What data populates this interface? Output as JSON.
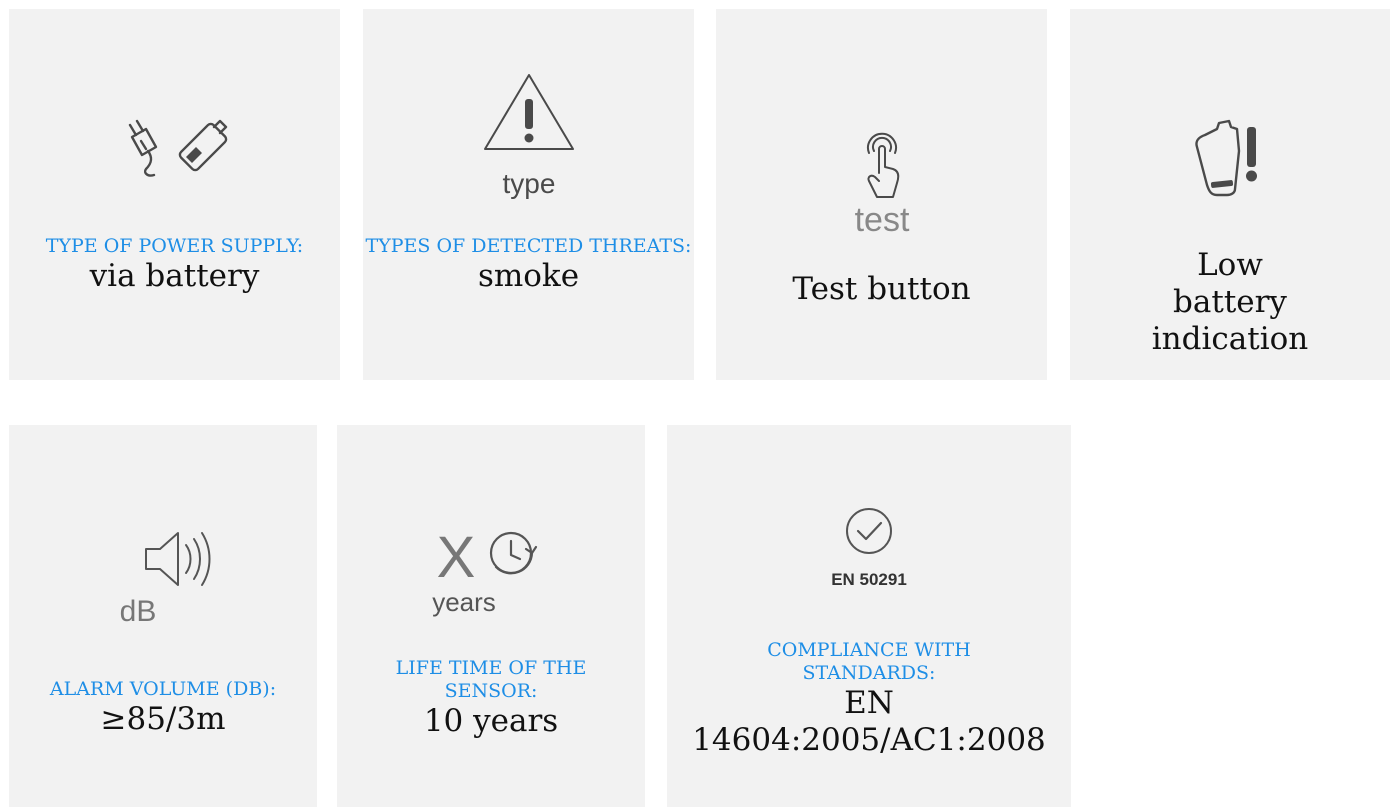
{
  "features": [
    {
      "id": "power",
      "icon": "plug-battery-icon",
      "label": "TYPE OF POWER SUPPLY:",
      "value": "via battery"
    },
    {
      "id": "threats",
      "icon": "warning-triangle-icon",
      "icon_text": "type",
      "label": "TYPES OF DETECTED THREATS:",
      "value": "smoke"
    },
    {
      "id": "test",
      "icon": "touch-finger-icon",
      "icon_text": "test",
      "label": "",
      "value": "Test button"
    },
    {
      "id": "low-battery",
      "icon": "battery-alert-icon",
      "label": "",
      "value": "Low battery indication"
    },
    {
      "id": "volume",
      "icon": "speaker-icon",
      "icon_text": "dB",
      "label": "ALARM VOLUME (DB):",
      "value": "≥85/3m"
    },
    {
      "id": "lifetime",
      "icon": "clock-refresh-icon",
      "icon_text": "X",
      "icon_text2": "years",
      "label": "LIFE TIME OF THE SENSOR:",
      "value": "10 years"
    },
    {
      "id": "standards",
      "icon": "check-circle-icon",
      "icon_text": "EN 50291",
      "label": "COMPLIANCE WITH STANDARDS:",
      "value": "EN 14604:2005/AC1:2008"
    }
  ],
  "colors": {
    "card_bg": "#f2f2f2",
    "label": "#1e8ee6",
    "value": "#111111",
    "icon": "#4a4a4a"
  }
}
